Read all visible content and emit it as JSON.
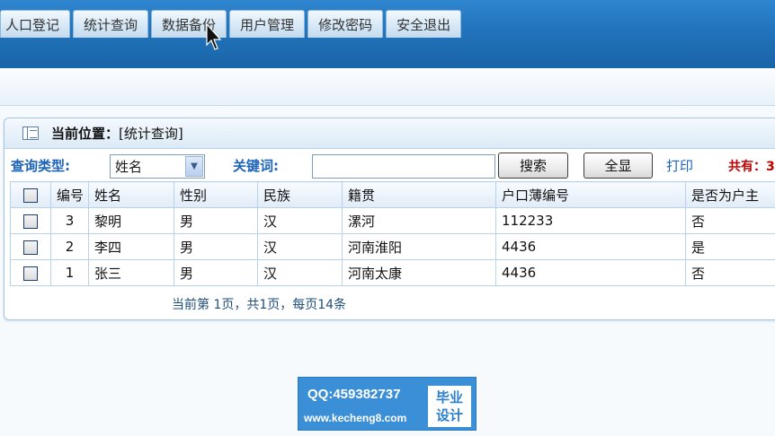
{
  "nav": {
    "tabs": [
      {
        "label": "人口登记"
      },
      {
        "label": "统计查询"
      },
      {
        "label": "数据备份"
      },
      {
        "label": "用户管理"
      },
      {
        "label": "修改密码"
      },
      {
        "label": "安全退出"
      }
    ]
  },
  "panel": {
    "location_label": "当前位置：",
    "location_value": "[统计查询]"
  },
  "search": {
    "type_label": "查询类型:",
    "type_selected": "姓名",
    "keyword_label": "关键词:",
    "keyword_value": "",
    "search_button": "搜索",
    "show_all_button": "全显",
    "print_link": "打印",
    "total_text": "共有：3"
  },
  "table": {
    "headers": [
      "编号",
      "姓名",
      "性别",
      "民族",
      "籍贯",
      "户口薄编号",
      "是否为户主"
    ],
    "rows": [
      {
        "id": "3",
        "name": "黎明",
        "gender": "男",
        "ethnicity": "汉",
        "hometown": "漯河",
        "hukou_no": "112233",
        "is_head": "否"
      },
      {
        "id": "2",
        "name": "李四",
        "gender": "男",
        "ethnicity": "汉",
        "hometown": "河南淮阳",
        "hukou_no": "4436",
        "is_head": "是"
      },
      {
        "id": "1",
        "name": "张三",
        "gender": "男",
        "ethnicity": "汉",
        "hometown": "河南太康",
        "hukou_no": "4436",
        "is_head": "否"
      }
    ]
  },
  "pager": {
    "text": "当前第 1页，共1页，每页14条"
  },
  "watermark": {
    "qq": "QQ:459382737",
    "url": "www.kecheng8.com",
    "badge_line1": "毕业",
    "badge_line2": "设计"
  },
  "colors": {
    "nav_blue": "#2173bb",
    "label_blue": "#1d63b8",
    "total_red": "#c00000"
  }
}
